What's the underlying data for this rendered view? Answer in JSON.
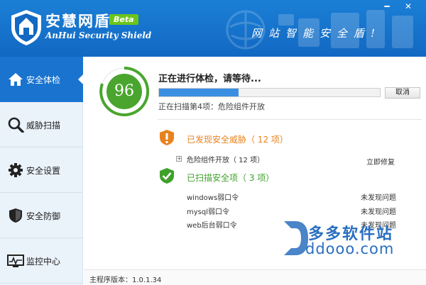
{
  "app": {
    "title": "安慧网盾",
    "badge": "Beta",
    "subtitle": "AnHui Security Shield",
    "slogan": "网站智能安全盾!",
    "minimize_glyph": "━",
    "close_glyph": "✕"
  },
  "sidebar": {
    "items": [
      {
        "label": "安全体检",
        "icon": "home-icon",
        "active": true
      },
      {
        "label": "威胁扫描",
        "icon": "magnifier-icon",
        "active": false
      },
      {
        "label": "安全设置",
        "icon": "gear-icon",
        "active": false
      },
      {
        "label": "安全防御",
        "icon": "shield-icon",
        "active": false
      },
      {
        "label": "监控中心",
        "icon": "monitor-icon",
        "active": false
      }
    ]
  },
  "scan": {
    "score": "96",
    "title": "正在进行体检，请等待...",
    "progress": 0.36,
    "cancel_label": "取消",
    "status": "正在扫描第4项：危险组件开放"
  },
  "threats": {
    "title": "已发现安全威胁（ 12 项）",
    "items": [
      {
        "name": "危险组件开放（ 12 项）",
        "action": "立即修复"
      }
    ]
  },
  "safe": {
    "title": "已扫描安全项（ 3 项）",
    "items": [
      {
        "name": "windows弱口令",
        "status": "未发现问题"
      },
      {
        "name": "mysql弱口令",
        "status": "未发现问题"
      },
      {
        "name": "web后台弱口令",
        "status": "未发现问题"
      }
    ]
  },
  "footer": {
    "version": "主程序版本：1.0.1.34"
  },
  "watermark": {
    "name": "多多软件站",
    "url": "ddooo.com"
  },
  "colors": {
    "header_blue": "#1268c2",
    "active_nav": "#1a74cf",
    "score_green": "#4aa52e",
    "threat_orange": "#e8821e",
    "safe_green": "#3fa12b",
    "progress_blue": "#3a8fe0"
  }
}
